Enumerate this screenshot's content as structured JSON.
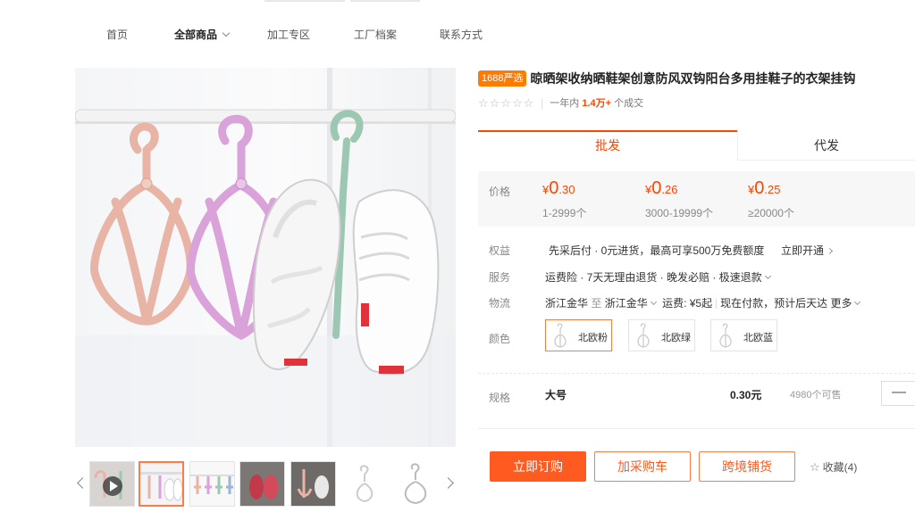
{
  "nav": {
    "items": [
      "首页",
      "全部商品",
      "加工专区",
      "工厂档案",
      "联系方式"
    ]
  },
  "product": {
    "badge": "1688严选",
    "title": "晾晒架收纳晒鞋架创意防风双钩阳台多用挂鞋子的衣架挂钩",
    "stars": "☆☆☆☆☆",
    "sold_prefix": "一年内",
    "sold_count": "1.4万+",
    "sold_suffix": "个成交"
  },
  "tabs": {
    "wholesale": "批发",
    "dropship": "代发"
  },
  "price": {
    "label": "价格",
    "currency": "¥",
    "tiers": [
      {
        "int": "0",
        "dec": ".30",
        "range": "1-2999个"
      },
      {
        "int": "0",
        "dec": ".26",
        "range": "3000-19999个"
      },
      {
        "int": "0",
        "dec": ".25",
        "range": "≥20000个"
      }
    ]
  },
  "benefits": {
    "label": "权益",
    "text": "先采后付 · 0元进货，最高可享500万免费额度",
    "action": "立即开通"
  },
  "service": {
    "label": "服务",
    "text": "运费险 · 7天无理由退货 · 晚发必赔 · 极速退款"
  },
  "logistics": {
    "label": "物流",
    "from": "浙江金华",
    "to_word": "至",
    "to": "浙江金华",
    "fee": "运费: ¥5起",
    "delivery": "现在付款，预计后天达",
    "more": "更多"
  },
  "color": {
    "label": "颜色",
    "options": [
      "北欧粉",
      "北欧绿",
      "北欧蓝"
    ],
    "selected": 0
  },
  "spec": {
    "label": "规格",
    "name": "大号",
    "price": "0.30元",
    "stock": "4980个可售",
    "minus": "—"
  },
  "actions": {
    "order": "立即订购",
    "cart": "加采购车",
    "crossborder": "跨境铺货",
    "favorite": "收藏(4)"
  },
  "colors": {
    "accent": "#ff5a1f",
    "price": "#ff4400",
    "badge": "#ff7a00",
    "hanger_pink": "#e8b4a6",
    "hanger_lilac": "#d9a2d8",
    "hanger_green": "#9cc7b2"
  }
}
